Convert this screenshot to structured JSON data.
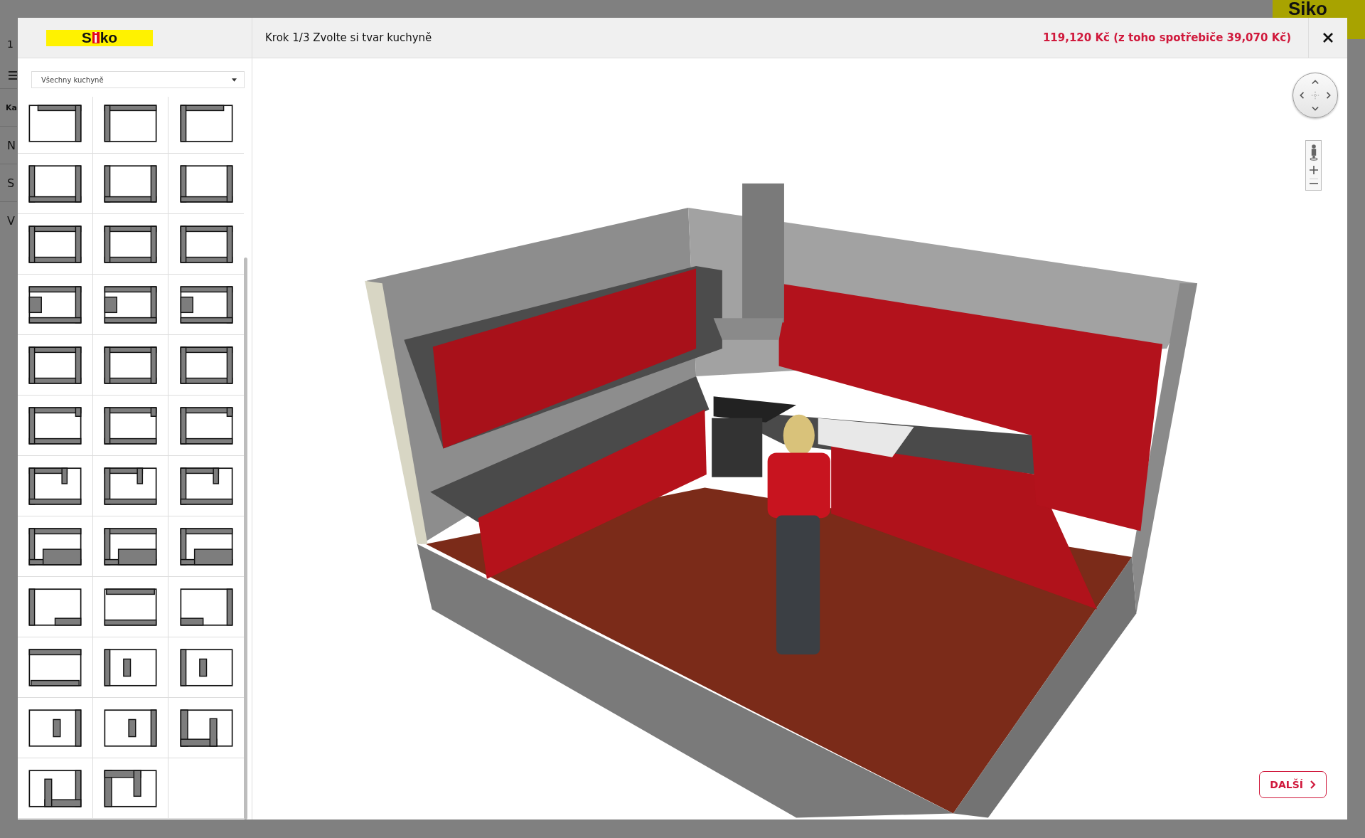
{
  "background": {
    "top_number": "1",
    "items": [
      {
        "label": "Ka",
        "bold": true
      },
      {
        "label": "N",
        "bold": false
      },
      {
        "label": "S",
        "bold": false
      },
      {
        "label": "V",
        "bold": false
      }
    ],
    "logo": "Siko"
  },
  "dialog": {
    "logo": "Siko",
    "step_title": "Krok 1/3 Zvolte si tvar kuchyně",
    "price": "119,120 Kč (z toho spotřebiče 39,070 Kč)",
    "filter": {
      "value": "Všechny kuchyně"
    },
    "next_button": "DALŠÍ"
  }
}
